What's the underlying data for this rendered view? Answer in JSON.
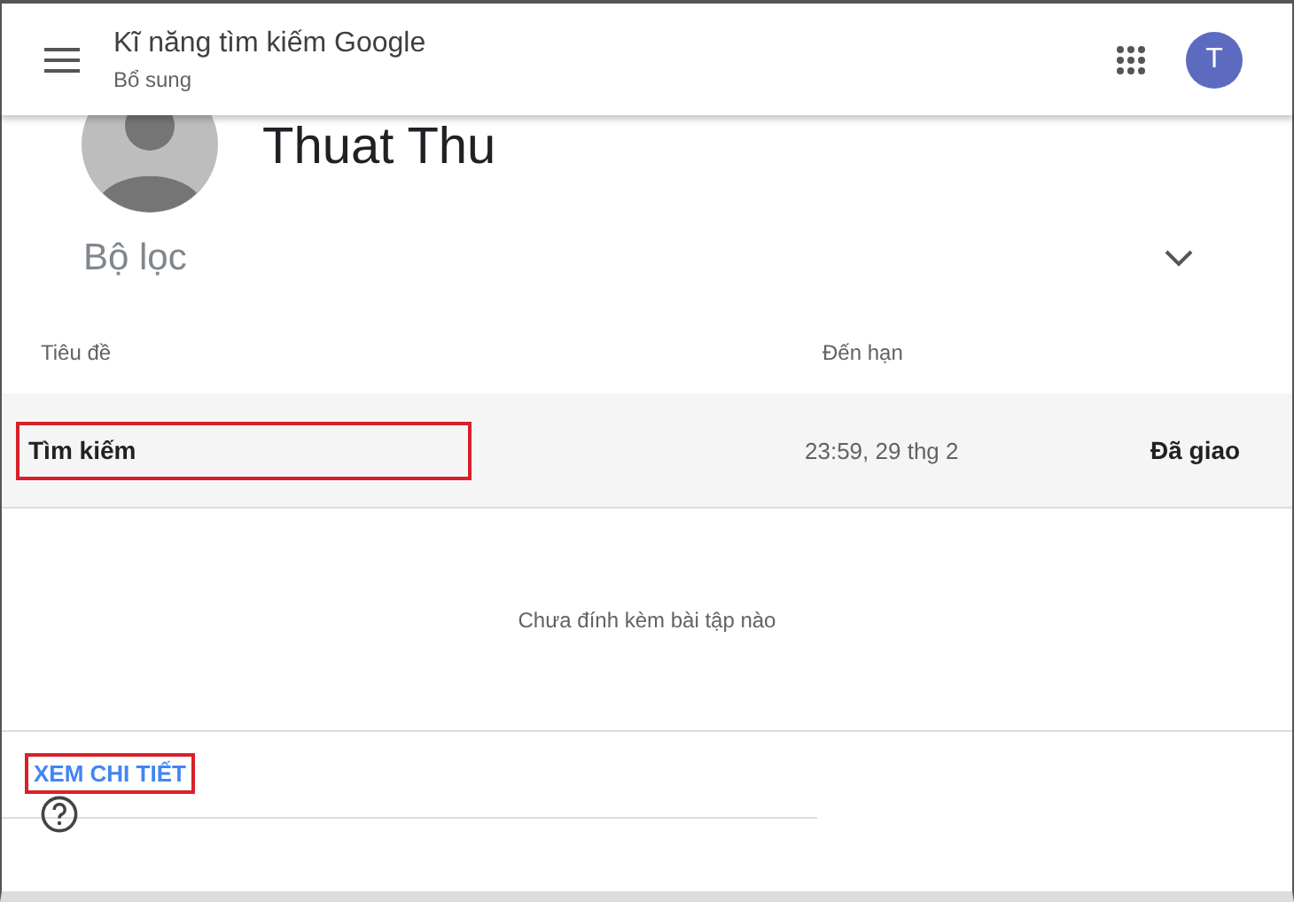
{
  "app_bar": {
    "title": "Kĩ năng tìm kiếm Google",
    "subtitle": "Bổ sung",
    "account_initial": "T"
  },
  "profile": {
    "name": "Thuat Thu"
  },
  "filter": {
    "label": "Bộ lọc",
    "expanded": false
  },
  "table": {
    "columns": [
      "Tiêu đề",
      "Đến hạn"
    ],
    "rows": [
      {
        "title": "Tìm kiếm",
        "due": "23:59, 29 thg 2",
        "status": "Đã giao",
        "highlighted": true
      }
    ]
  },
  "attachments": {
    "empty_text": "Chưa đính kèm bài tập nào"
  },
  "details_link": {
    "label": "XEM CHI TIẾT",
    "highlighted": true
  }
}
